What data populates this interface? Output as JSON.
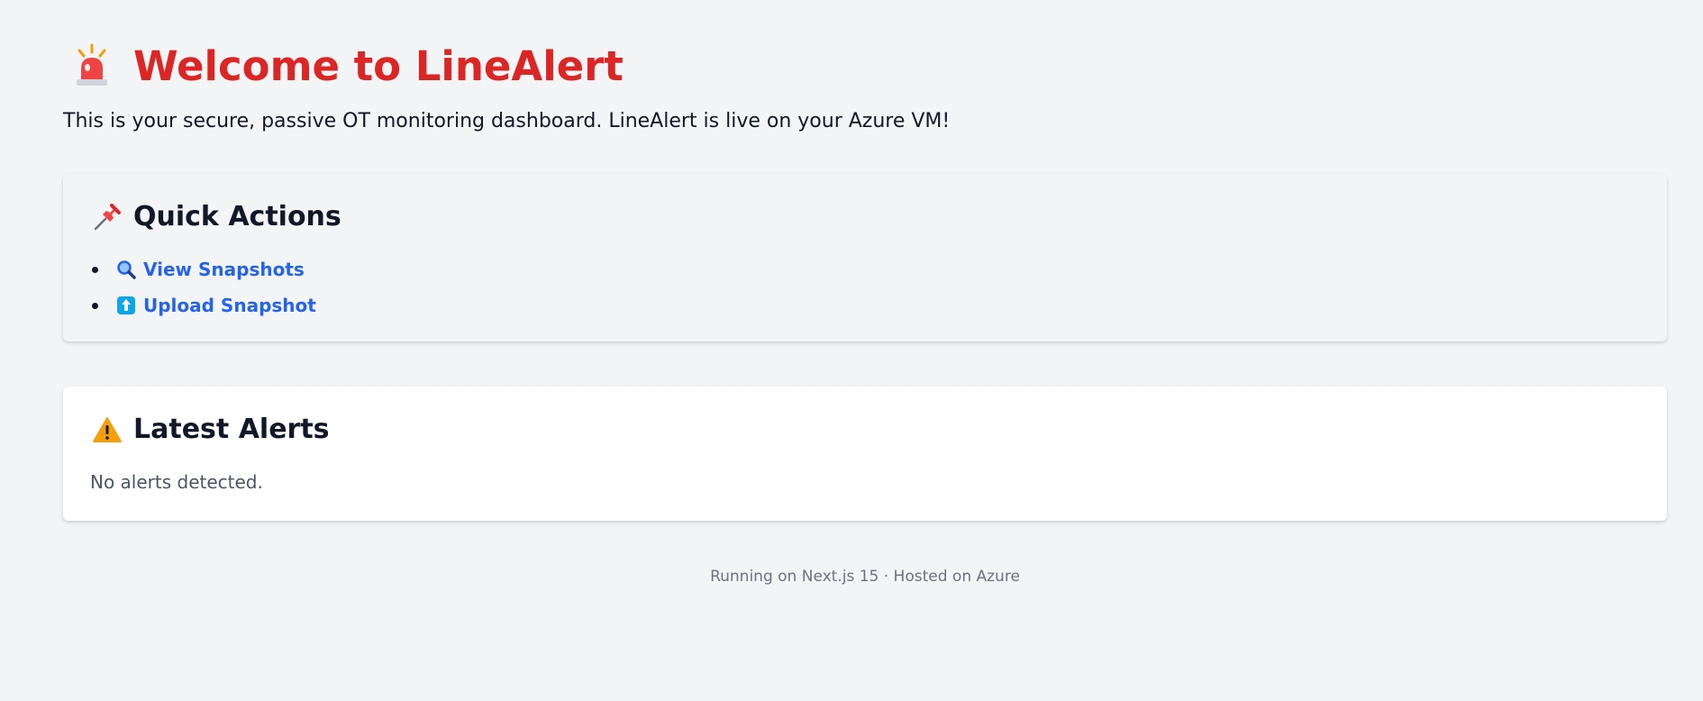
{
  "header": {
    "icon": "siren-icon",
    "title": "Welcome to LineAlert",
    "subtitle": "This is your secure, passive OT monitoring dashboard. LineAlert is live on your Azure VM!"
  },
  "quick_actions": {
    "icon": "pushpin-icon",
    "heading": "Quick Actions",
    "items": [
      {
        "icon": "magnifier-icon",
        "label": "View Snapshots"
      },
      {
        "icon": "upload-arrow-icon",
        "label": "Upload Snapshot"
      }
    ]
  },
  "latest_alerts": {
    "icon": "warning-icon",
    "heading": "Latest Alerts",
    "empty_message": "No alerts detected."
  },
  "footer": {
    "text": "Running on Next.js 15 · Hosted on Azure"
  },
  "colors": {
    "background": "#f3f4f6",
    "title": "#dc2626",
    "link": "#2563eb",
    "card": "#ffffff"
  }
}
